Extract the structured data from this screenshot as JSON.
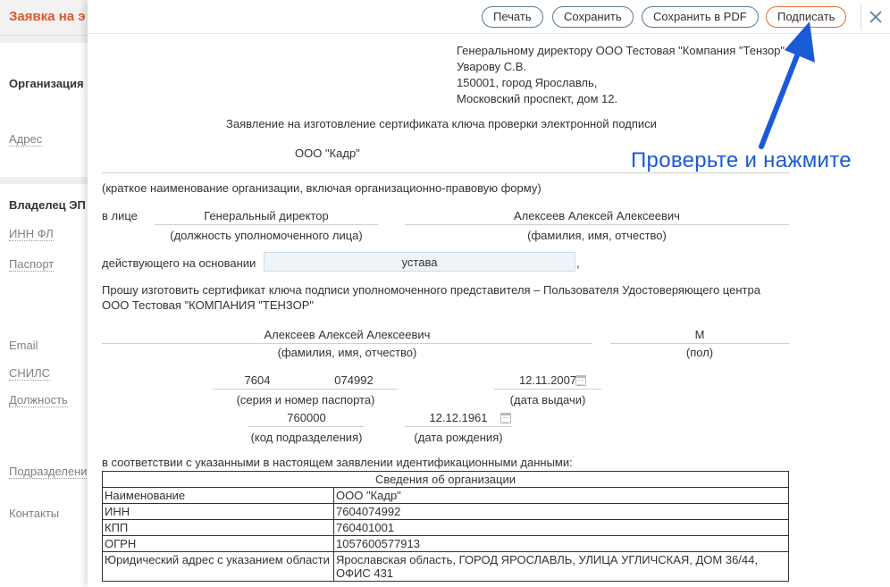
{
  "background": {
    "title": "Заявка на э",
    "items": [
      "Организация",
      "Адрес",
      "Владелец ЭП",
      "ИНН ФЛ",
      "Паспорт",
      "Email",
      "СНИЛС",
      "Должность",
      "Подразделение",
      "Контакты"
    ]
  },
  "toolbar": {
    "print": "Печать",
    "save": "Сохранить",
    "save_pdf": "Сохранить в PDF",
    "sign": "Подписать"
  },
  "document": {
    "addressee": [
      "Генеральному директору ООО Тестовая \"Компания \"Тензор\"",
      "Уварову С.В.",
      "150001, город Ярославль,",
      "Московский проспект, дом 12."
    ],
    "heading": "Заявление на изготовление сертификата ключа проверки электронной подписи",
    "org_name": "ООО \"Кадр\"",
    "org_caption": "(краткое наименование организации, включая организационно-правовую форму)",
    "in_person": "в лице",
    "position": "Генеральный директор",
    "position_caption": "(должность уполномоченного лица)",
    "person_name": "Алексеев Алексей Алексеевич",
    "person_caption": "(фамилия, имя, отчество)",
    "basis_label": "действующего на основании",
    "basis_value": "устава",
    "comma": ",",
    "request_line1": "Прошу изготовить сертификат ключа подписи уполномоченного представителя – Пользователя Удостоверяющего центра",
    "request_line2": "ООО Тестовая \"КОМПАНИЯ \"ТЕНЗОР\"",
    "holder_name": "Алексеев Алексей Алексеевич",
    "holder_caption": "(фамилия, имя, отчество)",
    "gender": "М",
    "gender_caption": "(пол)",
    "passport_series": "7604",
    "passport_number": "074992",
    "passport_caption": "(серия и номер паспорта)",
    "issue_date": "12.11.2007",
    "issue_caption": "(дата выдачи)",
    "division_code": "760000",
    "division_caption": "(код подразделения)",
    "birth_date": "12.12.1961",
    "birth_caption": "(дата рождения)",
    "accordance": "в соответствии с указанными в настоящем заявлении идентификационными данными:"
  },
  "org_table": {
    "title": "Сведения об организации",
    "rows": [
      {
        "label": "Наименование",
        "value": "ООО \"Кадр\""
      },
      {
        "label": "ИНН",
        "value": "7604074992"
      },
      {
        "label": "КПП",
        "value": "760401001"
      },
      {
        "label": "ОГРН",
        "value": "1057600577913"
      },
      {
        "label": "Юридический адрес с указанием области",
        "value": "Ярославская область, ГОРОД ЯРОСЛАВЛЬ, УЛИЦА УГЛИЧСКАЯ, ДОМ 36/44, ОФИС 431"
      }
    ]
  },
  "annotation": {
    "hint": "Проверьте и нажмите",
    "color": "#1a5ad6"
  },
  "colors": {
    "accent": "#e15728",
    "button_border": "#5b7896",
    "sign_border": "#e66b2e"
  }
}
